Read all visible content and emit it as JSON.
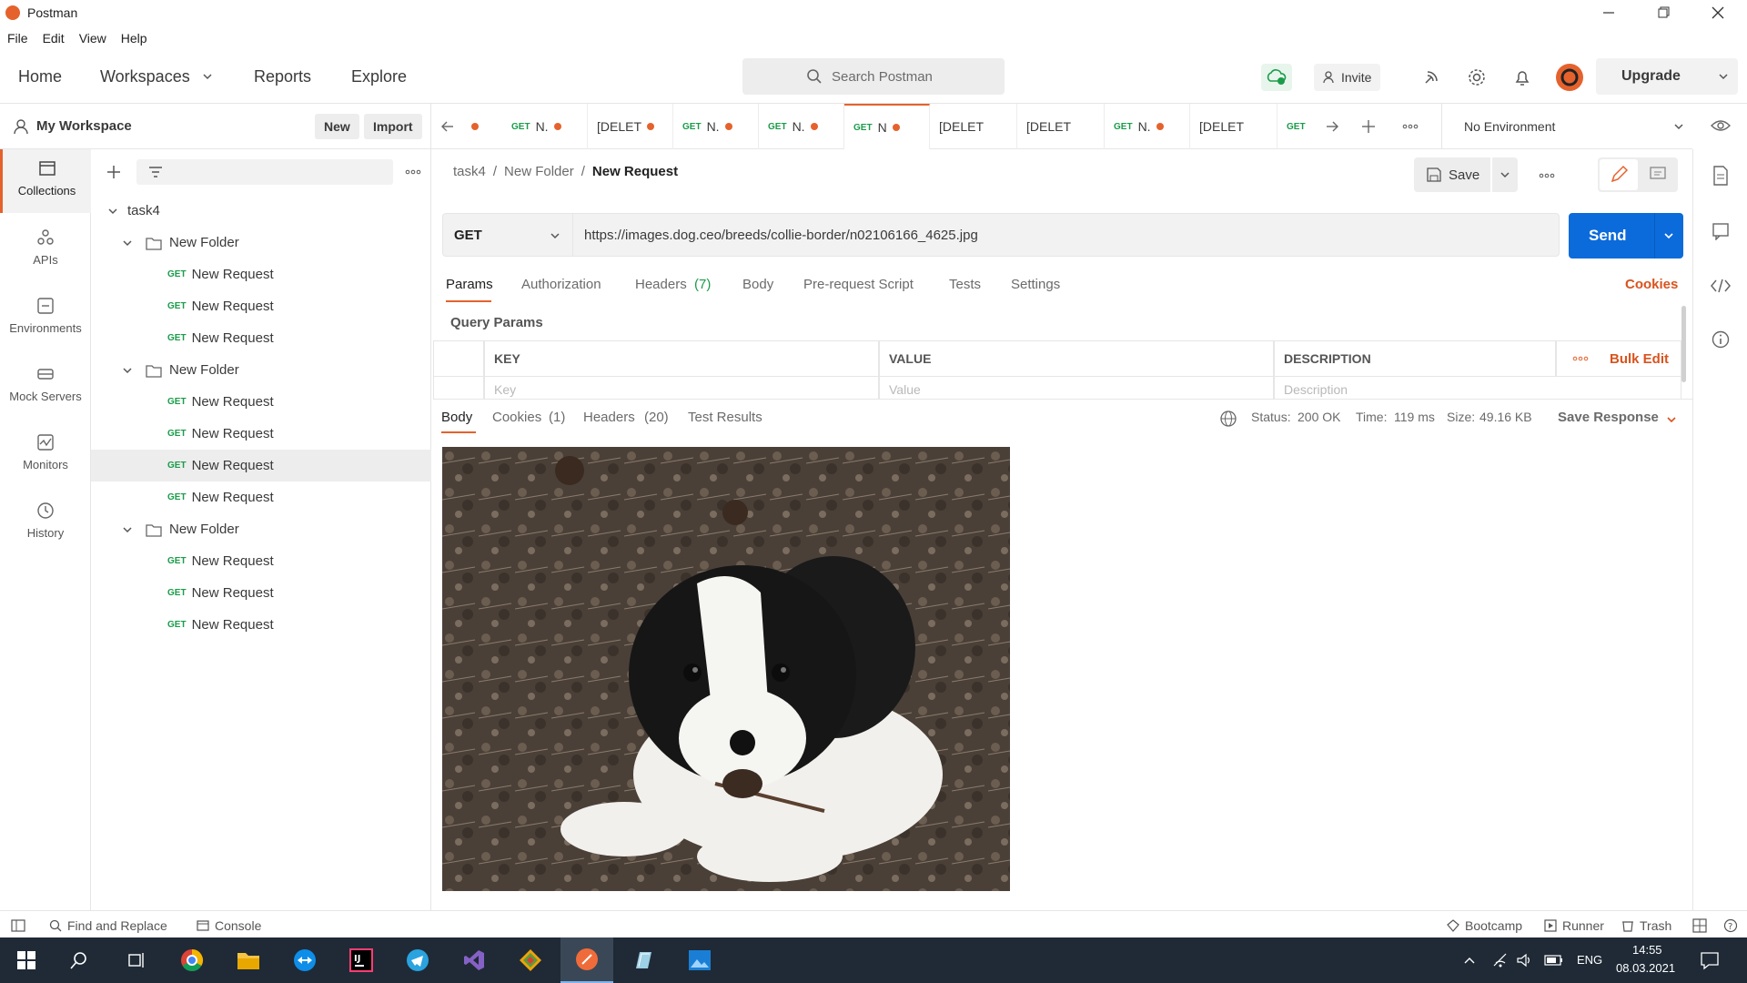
{
  "app": {
    "title": "Postman"
  },
  "menu": [
    "File",
    "Edit",
    "View",
    "Help"
  ],
  "header": {
    "nav": [
      "Home",
      "Workspaces",
      "Reports",
      "Explore"
    ],
    "search_placeholder": "Search Postman",
    "invite": "Invite",
    "upgrade": "Upgrade"
  },
  "workspace": {
    "name": "My Workspace",
    "new": "New",
    "import": "Import"
  },
  "rail": [
    {
      "label": "Collections",
      "icon": "collections-icon"
    },
    {
      "label": "APIs",
      "icon": "apis-icon"
    },
    {
      "label": "Environments",
      "icon": "environments-icon"
    },
    {
      "label": "Mock Servers",
      "icon": "mock-servers-icon"
    },
    {
      "label": "Monitors",
      "icon": "monitors-icon"
    },
    {
      "label": "History",
      "icon": "history-icon"
    }
  ],
  "tree": {
    "collection": "task4",
    "method": "GET",
    "folder_label": "New Folder",
    "request_label": "New Request"
  },
  "tabs": [
    {
      "method": "",
      "label": "",
      "dot": true
    },
    {
      "method": "GET",
      "label": "N.",
      "dot": true
    },
    {
      "method": "",
      "label": "[DELET",
      "dot": true
    },
    {
      "method": "GET",
      "label": "N.",
      "dot": true
    },
    {
      "method": "GET",
      "label": "N.",
      "dot": true
    },
    {
      "method": "GET",
      "label": "N",
      "dot": true,
      "active": true
    },
    {
      "method": "",
      "label": "[DELET",
      "dot": false
    },
    {
      "method": "",
      "label": "[DELET",
      "dot": false
    },
    {
      "method": "GET",
      "label": "N.",
      "dot": true
    },
    {
      "method": "",
      "label": "[DELET",
      "dot": false
    },
    {
      "method": "GET",
      "label": "",
      "dot": false
    }
  ],
  "environment": {
    "selected": "No Environment"
  },
  "request": {
    "breadcrumb": [
      "task4",
      "New Folder",
      "New Request"
    ],
    "save": "Save",
    "method": "GET",
    "url": "https://images.dog.ceo/breeds/collie-border/n02106166_4625.jpg",
    "send": "Send",
    "tabs": [
      "Params",
      "Authorization",
      "Headers",
      "Body",
      "Pre-request Script",
      "Tests",
      "Settings"
    ],
    "headers_count": "(7)",
    "cookies": "Cookies",
    "query_params_title": "Query Params",
    "table_headers": [
      "KEY",
      "VALUE",
      "DESCRIPTION"
    ],
    "bulk_edit": "Bulk Edit",
    "placeholders": [
      "Key",
      "Value",
      "Description"
    ]
  },
  "response": {
    "tabs": {
      "body": "Body",
      "cookies": "Cookies",
      "cookies_count": "(1)",
      "headers": "Headers",
      "headers_count": "(20)",
      "tests": "Test Results"
    },
    "status_label": "Status:",
    "status": "200 OK",
    "time_label": "Time:",
    "time": "119 ms",
    "size_label": "Size:",
    "size": "49.16 KB",
    "save_response": "Save Response"
  },
  "footer": {
    "find_replace": "Find and Replace",
    "console": "Console",
    "bootcamp": "Bootcamp",
    "runner": "Runner",
    "trash": "Trash"
  },
  "taskbar": {
    "lang": "ENG",
    "time": "14:55",
    "date": "08.03.2021"
  },
  "colors": {
    "accent": "#e5622d",
    "send": "#0b6bdb",
    "get": "#1a9c4a"
  }
}
